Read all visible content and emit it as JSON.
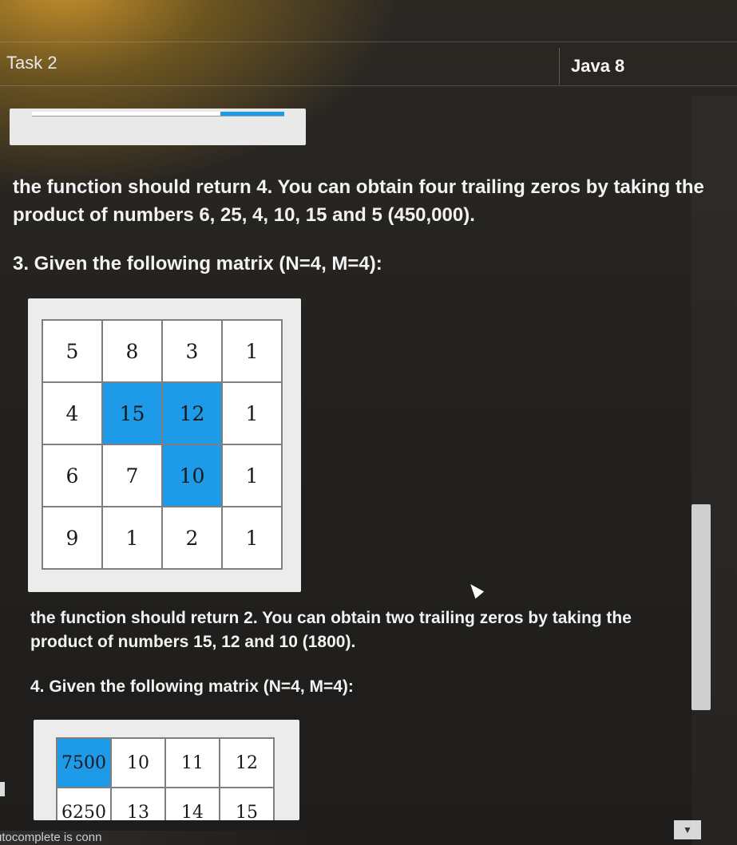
{
  "header": {
    "task_title": "Task 2",
    "language": "Java 8"
  },
  "description": {
    "para1": "the function should return 4. You can obtain four trailing zeros by taking the product of numbers 6, 25, 4, 10, 15 and 5 (450,000).",
    "para2": "3. Given the following matrix (N=4, M=4):",
    "para3": "the function should return 2. You can obtain two trailing zeros by taking the product of numbers 15, 12 and 10 (1800).",
    "para4": "4. Given the following matrix (N=4, M=4):"
  },
  "matrix3": {
    "rows": [
      [
        "5",
        "8",
        "3",
        "1"
      ],
      [
        "4",
        "15",
        "12",
        "1"
      ],
      [
        "6",
        "7",
        "10",
        "1"
      ],
      [
        "9",
        "1",
        "2",
        "1"
      ]
    ],
    "highlighted": [
      [
        1,
        1
      ],
      [
        1,
        2
      ],
      [
        2,
        2
      ]
    ],
    "highlight_color": "#1e9be8"
  },
  "matrix4": {
    "rows": [
      [
        "7500",
        "10",
        "11",
        "12"
      ],
      [
        "6250",
        "13",
        "14",
        "15"
      ]
    ],
    "highlighted": [
      [
        0,
        0
      ]
    ],
    "highlight_color": "#1e9be8"
  },
  "status": {
    "autocomplete_text": "utocomplete is conn"
  },
  "colors": {
    "accent": "#1e9be8",
    "background": "#24221f",
    "text": "#f2f2f2"
  }
}
